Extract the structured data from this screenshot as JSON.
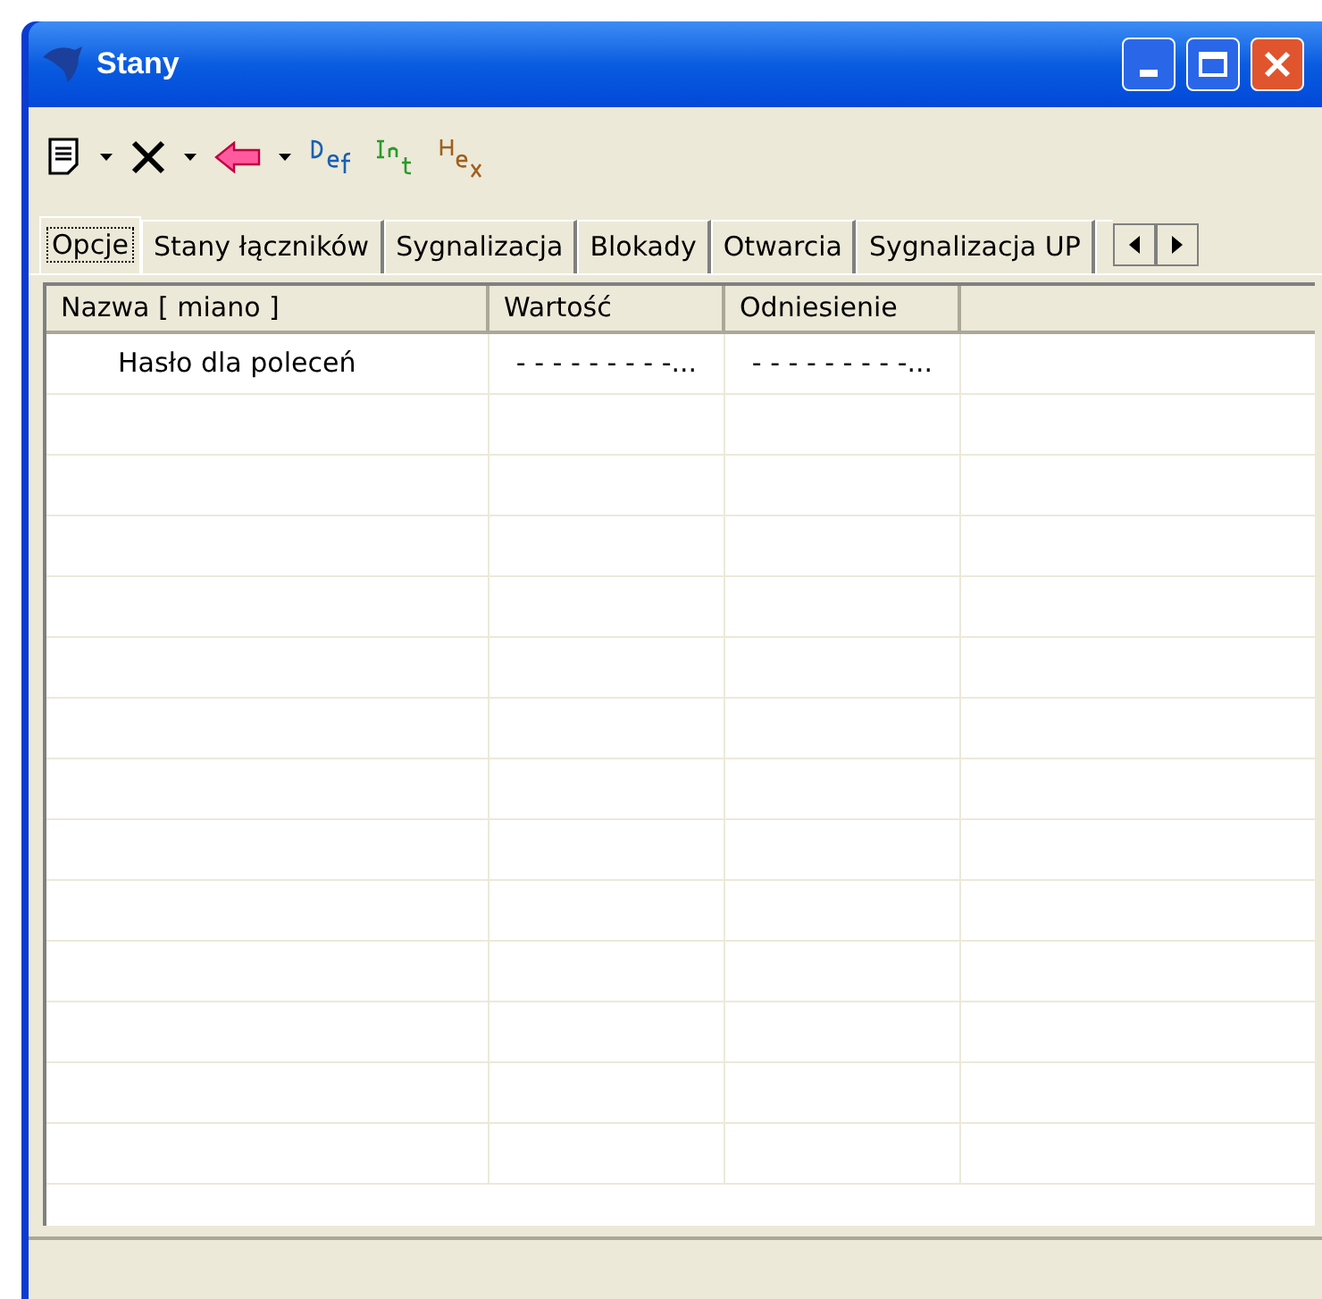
{
  "window": {
    "title": "Stany"
  },
  "tabs": [
    {
      "label": "Opcje",
      "selected": true
    },
    {
      "label": "Stany łączników",
      "selected": false
    },
    {
      "label": "Sygnalizacja",
      "selected": false
    },
    {
      "label": "Blokady",
      "selected": false
    },
    {
      "label": "Otwarcia",
      "selected": false
    },
    {
      "label": "Sygnalizacja UP",
      "selected": false
    }
  ],
  "table": {
    "columns": [
      "Nazwa [ miano ]",
      "Wartość",
      "Odniesienie"
    ],
    "rows": [
      [
        "Hasło dla poleceń",
        "- - - - - - - - -...",
        "- - - - - - - - -..."
      ]
    ]
  }
}
